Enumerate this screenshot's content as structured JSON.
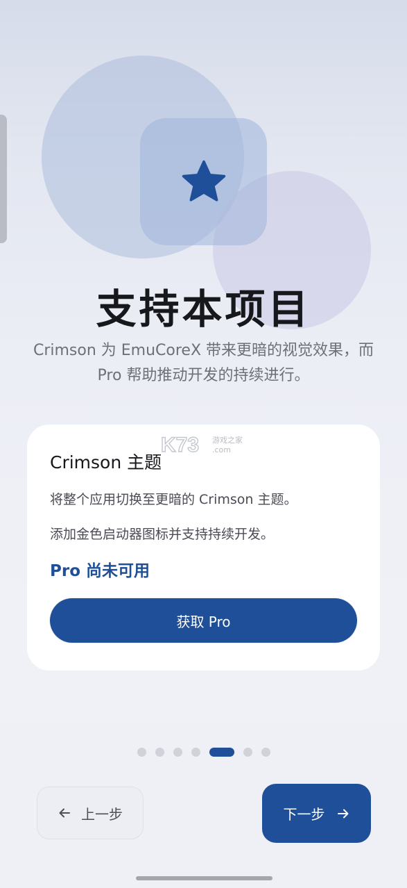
{
  "hero": {
    "icon": "star-icon",
    "title": "支持本项目",
    "subtitle": "Crimson 为 EmuCoreX 带来更暗的视觉效果，而 Pro 帮助推动开发的持续进行。"
  },
  "card": {
    "title": "Crimson 主题",
    "line1": "将整个应用切换至更暗的 Crimson 主题。",
    "line2": "添加金色启动器图标并支持持续开发。",
    "status": "Pro 尚未可用",
    "button_label": "获取 Pro"
  },
  "pagination": {
    "total": 7,
    "current": 5
  },
  "nav": {
    "prev_label": "上一步",
    "next_label": "下一步"
  },
  "colors": {
    "accent": "#1f4f98",
    "card_bg": "#ffffff",
    "dot_inactive": "#d0d2d9"
  },
  "watermark": {
    "brand": "K73",
    "site_name": "游戏之家",
    "domain": ".com"
  }
}
